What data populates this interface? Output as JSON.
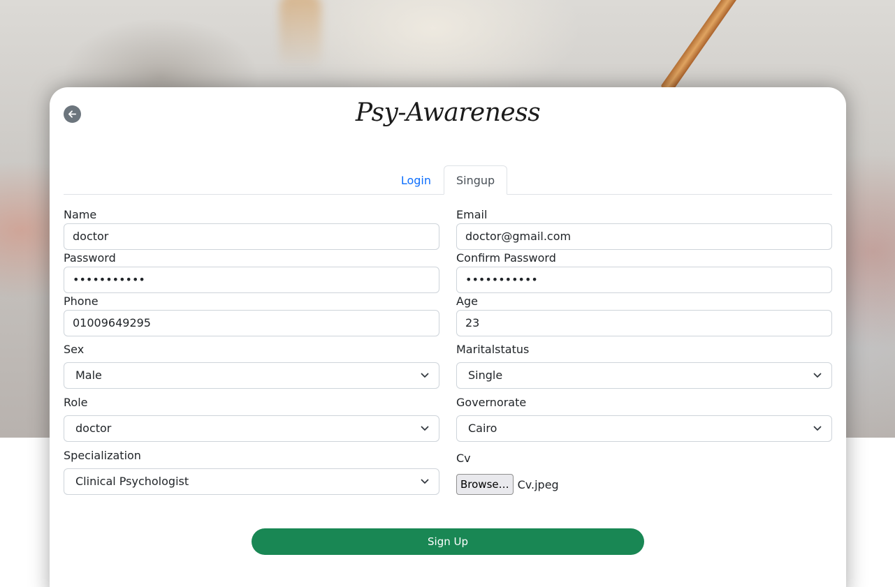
{
  "brand": {
    "title": "Psy-Awareness"
  },
  "tabs": [
    {
      "label": "Login",
      "active": false
    },
    {
      "label": "Singup",
      "active": true
    }
  ],
  "form": {
    "name": {
      "label": "Name",
      "value": "doctor"
    },
    "email": {
      "label": "Email",
      "value": "doctor@gmail.com"
    },
    "password": {
      "label": "Password",
      "value": "•••••••••••"
    },
    "confirm_password": {
      "label": "Confirm Password",
      "value": "•••••••••••"
    },
    "phone": {
      "label": "Phone",
      "value": "01009649295"
    },
    "age": {
      "label": "Age",
      "value": "23"
    },
    "sex": {
      "label": "Sex",
      "value": "Male"
    },
    "marital_status": {
      "label": "Maritalstatus",
      "value": "Single"
    },
    "role": {
      "label": "Role",
      "value": "doctor"
    },
    "governorate": {
      "label": "Governorate",
      "value": "Cairo"
    },
    "specialization": {
      "label": "Specialization",
      "value": "Clinical Psychologist"
    },
    "cv": {
      "label": "Cv",
      "button_label": "Browse…",
      "file_name": "Cv.jpeg"
    },
    "submit_label": "Sign Up"
  },
  "icons": {
    "back": "arrow-left-circle-icon",
    "select": "chevron-down-icon"
  },
  "colors": {
    "link": "#0d6efd",
    "submit": "#198754",
    "back_button": "#6c757d"
  }
}
